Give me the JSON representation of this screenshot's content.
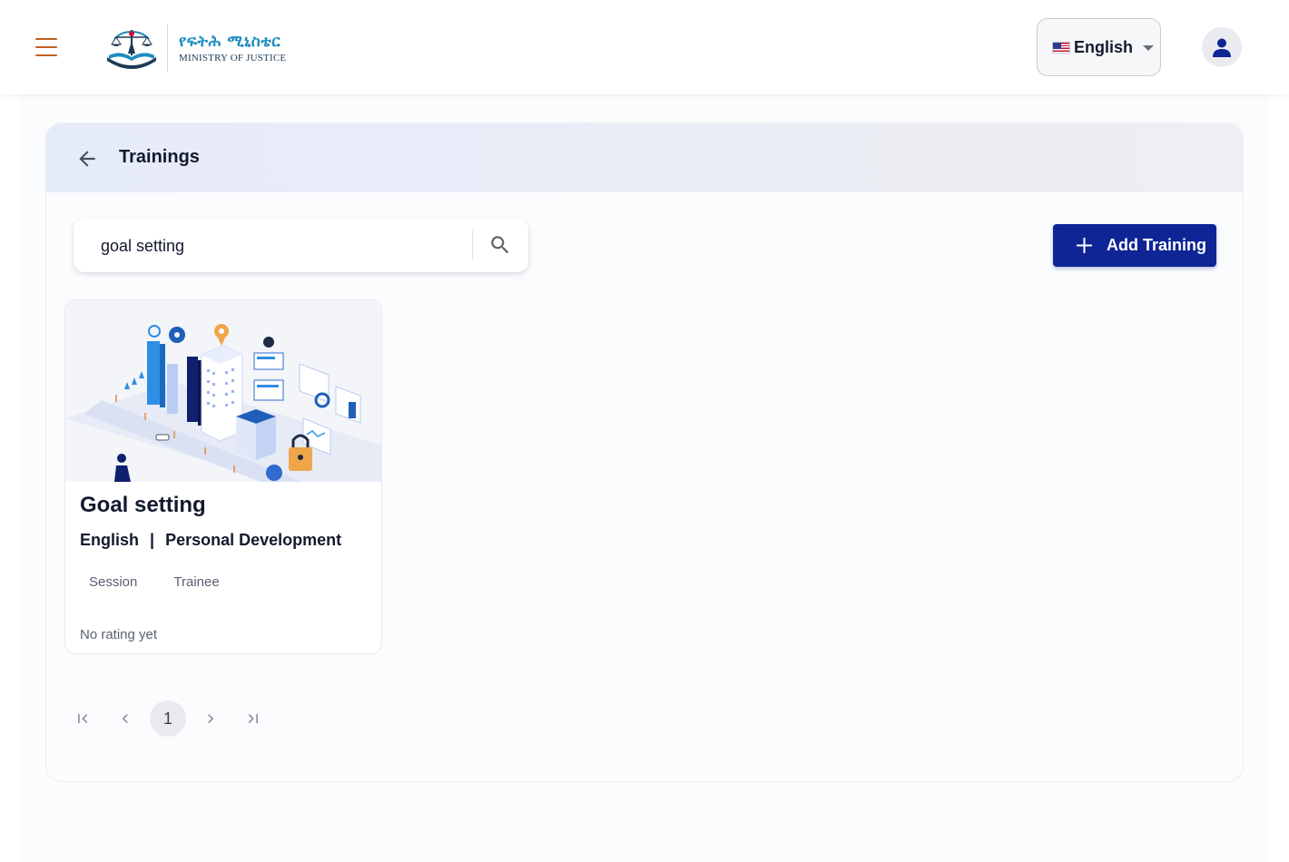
{
  "header": {
    "logo": {
      "amharic": "የፍትሕ ሚኒስቴር",
      "english": "MINISTRY OF JUSTICE"
    },
    "language": {
      "selected": "English",
      "flag": "us-flag-icon"
    },
    "icons": {
      "menu": "hamburger-menu-icon",
      "user": "user-icon"
    },
    "colors": {
      "menu_icon": "#c0601f",
      "user_icon": "#0f2596"
    }
  },
  "panel": {
    "title": "Trainings",
    "search": {
      "value": "goal setting",
      "placeholder": ""
    },
    "add_button_label": "Add Training",
    "colors": {
      "primary": "#0f2596"
    }
  },
  "trainings": [
    {
      "title": "Goal setting",
      "language": "English",
      "separator": "|",
      "category": "Personal Development",
      "session_label": "Session",
      "trainee_label": "Trainee",
      "rating_text": "No rating yet"
    }
  ],
  "pagination": {
    "current_page": "1"
  }
}
